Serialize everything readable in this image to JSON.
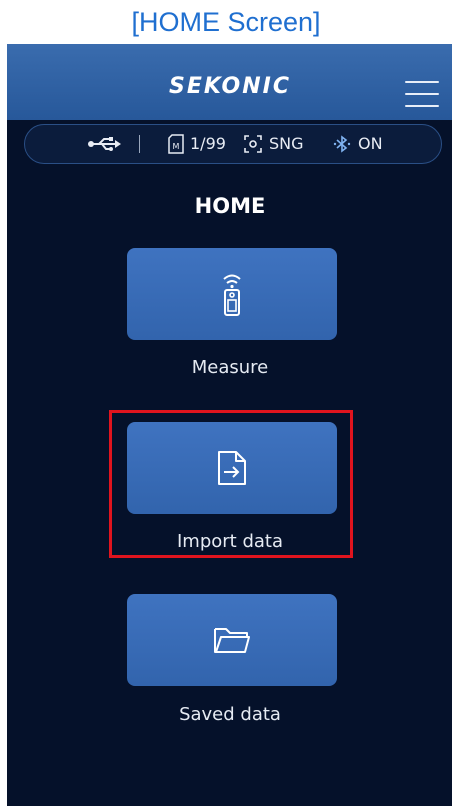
{
  "caption": "[HOME Screen]",
  "header": {
    "logo": "SEKONIC",
    "menu_icon": "hamburger-menu-icon"
  },
  "status": {
    "usb_icon": "usb-icon",
    "card_icon": "memory-card-icon",
    "memory": "1/99",
    "mode_icon": "focus-icon",
    "mode": "SNG",
    "bluetooth_icon": "bluetooth-icon",
    "bluetooth": "ON"
  },
  "page": {
    "title": "HOME"
  },
  "buttons": [
    {
      "label": "Measure",
      "icon": "light-meter-icon"
    },
    {
      "label": "Import data",
      "icon": "import-file-icon"
    },
    {
      "label": "Saved data",
      "icon": "folder-icon"
    }
  ],
  "colors": {
    "caption": "#1f6fd0",
    "background": "#05112a",
    "header": "#3a6cae",
    "button": "#3a6cb8",
    "highlight": "#e0141e"
  }
}
